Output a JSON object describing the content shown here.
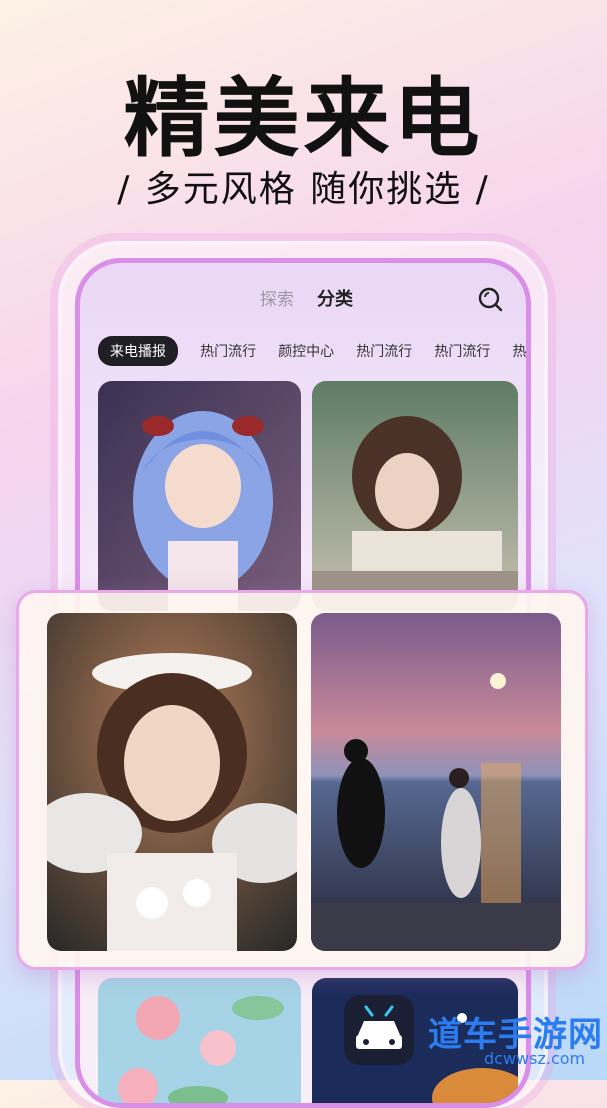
{
  "promo": {
    "headline": "精美来电",
    "subline": "/ 多元风格  随你挑选 /"
  },
  "app": {
    "tabs": [
      {
        "label": "探索",
        "active": false
      },
      {
        "label": "分类",
        "active": true
      }
    ],
    "search_icon": "search-icon",
    "categories": [
      {
        "label": "来电播报",
        "active": true
      },
      {
        "label": "热门流行",
        "active": false
      },
      {
        "label": "颜控中心",
        "active": false
      },
      {
        "label": "热门流行",
        "active": false
      },
      {
        "label": "热门流行",
        "active": false
      },
      {
        "label": "热门",
        "active": false
      }
    ],
    "wallpapers": [
      {
        "subject": "anime-girl"
      },
      {
        "subject": "woman-reading"
      },
      {
        "subject": "flower-fields"
      },
      {
        "subject": "space"
      }
    ]
  },
  "featured": {
    "wallpapers": [
      {
        "subject": "angel-portrait"
      },
      {
        "subject": "sunset-couple"
      }
    ]
  },
  "watermark": {
    "brand": "道车手游网",
    "url": "dcwwsz.com"
  },
  "colors": {
    "accent": "#d98ee8",
    "active_chip": "#1f1f24",
    "watermark_blue": "#2b7cf0"
  }
}
